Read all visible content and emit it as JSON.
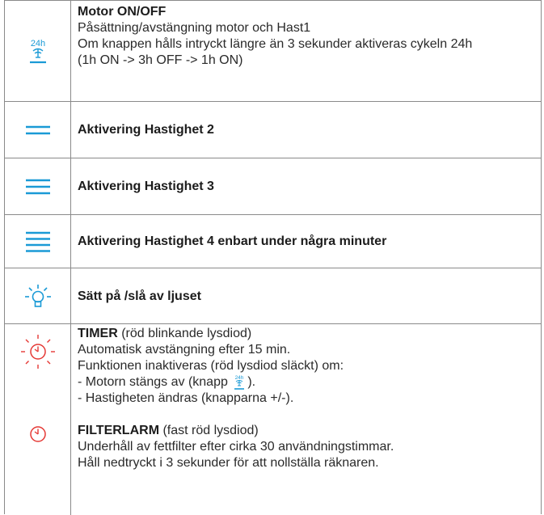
{
  "colors": {
    "blue": "#1a9ad6",
    "red": "#e53935",
    "border": "#8a8a8a"
  },
  "rows": [
    {
      "icon": "motor-24h-icon",
      "icon_text": "24h",
      "title": "Motor ON/OFF",
      "lines": [
        "Påsättning/avstängning motor och Hast1",
        "Om knappen hålls intryckt längre än 3 sekunder aktiveras cykeln 24h",
        "(1h ON -> 3h OFF -> 1h ON)"
      ]
    },
    {
      "icon": "speed-2-icon",
      "title": "Aktivering Hastighet 2"
    },
    {
      "icon": "speed-3-icon",
      "title": "Aktivering Hastighet 3"
    },
    {
      "icon": "speed-4-icon",
      "title": "Aktivering Hastighet 4 enbart under några minuter"
    },
    {
      "icon": "light-bulb-icon",
      "title": "Sätt på /slå av ljuset"
    },
    {
      "icons": [
        "timer-blinking-icon",
        "timer-steady-icon"
      ],
      "timer_title": "TIMER",
      "timer_note": " (röd blinkande lysdiod)",
      "timer_lines": [
        "Automatisk avstängning efter 15 min.",
        "Funktionen inaktiveras (röd lysdiod släckt) om:"
      ],
      "timer_motor_prefix": "- Motorn stängs av (knapp ",
      "timer_motor_suffix": ").",
      "timer_speed_line": "- Hastigheten ändras (knapparna +/-).",
      "filter_title": "FILTERLARM",
      "filter_note": " (fast röd lysdiod)",
      "filter_lines": [
        "Underhåll av fettfilter efter cirka 30 användningstimmar.",
        "Håll nedtryckt i 3 sekunder för att nollställa räknaren."
      ]
    }
  ]
}
